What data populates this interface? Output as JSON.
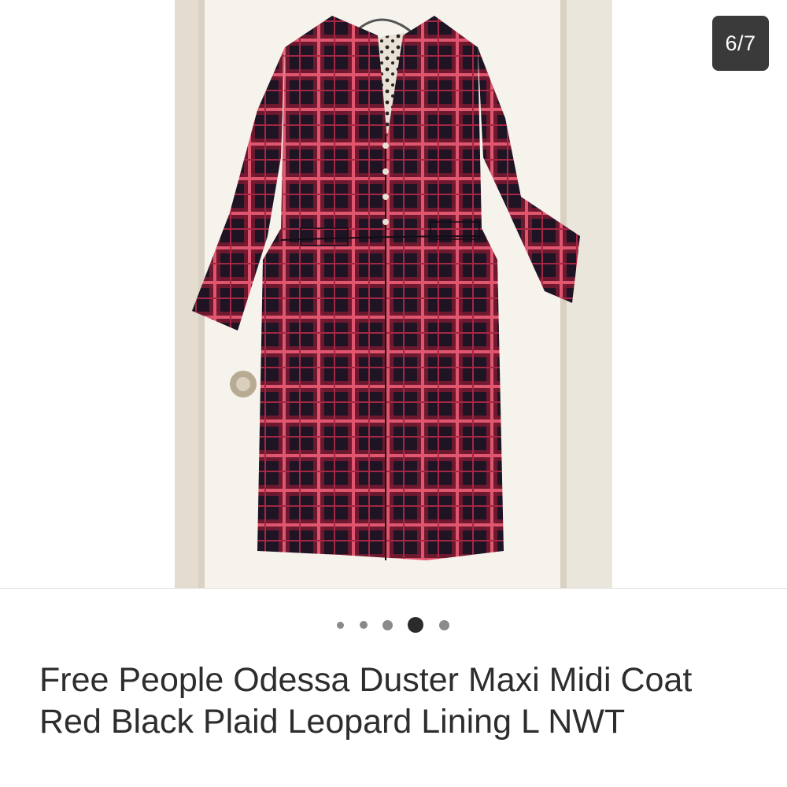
{
  "gallery": {
    "counter": "6/7",
    "current_index": 4,
    "indicator_count": 5,
    "photo": {
      "icon": "product-photo",
      "description_colors": {
        "plaid_red": "#b0243d",
        "plaid_black": "#1e1424",
        "door": "#f2efe8"
      }
    }
  },
  "listing": {
    "title": "Free People Odessa Duster Maxi Midi Coat Red Black Plaid Leopard Lining L NWT"
  },
  "colors": {
    "counter_bg": "#3a3a3a",
    "dot_inactive": "#8a8a8a",
    "dot_active": "#2b2b2b",
    "text": "#2d2d2d"
  }
}
